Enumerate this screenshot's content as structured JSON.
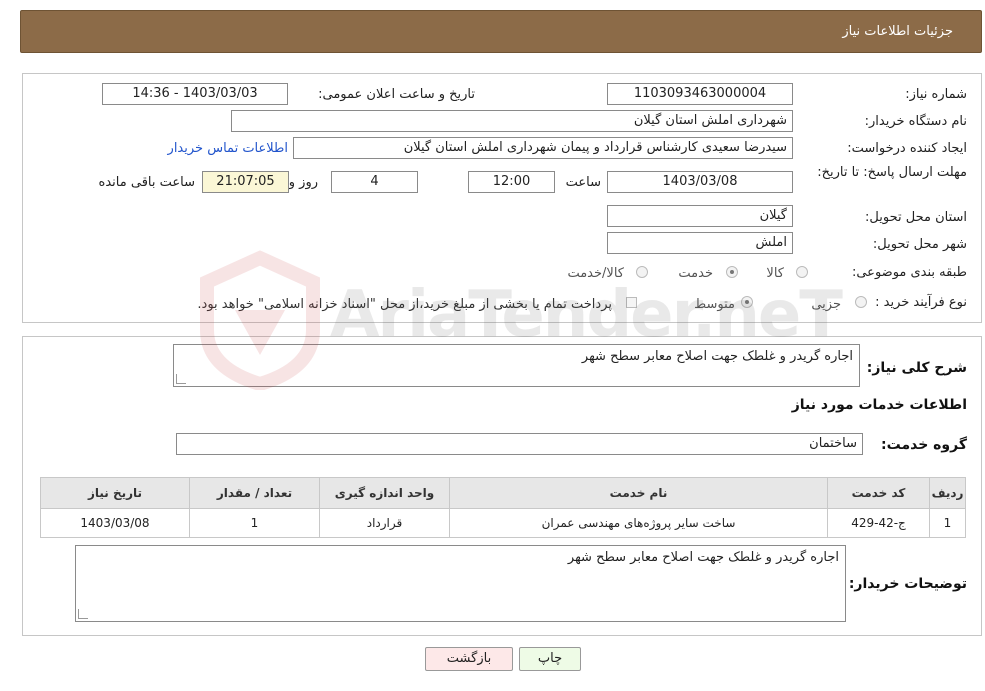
{
  "header": {
    "title": "جزئیات اطلاعات نیاز"
  },
  "form": {
    "need_number": {
      "label": "شماره نیاز:",
      "value": "1103093463000004"
    },
    "announce_datetime": {
      "label": "تاریخ و ساعت اعلان عمومی:",
      "value": "1403/03/03 - 14:36"
    },
    "buyer_org": {
      "label": "نام دستگاه خریدار:",
      "value": "شهرداری املش استان گیلان"
    },
    "creator": {
      "label": "ایجاد کننده درخواست:",
      "value": "سیدرضا سعیدی کارشناس قرارداد و پیمان شهرداری املش استان گیلان",
      "contact_link": "اطلاعات تماس خریدار"
    },
    "deadline": {
      "label": "مهلت ارسال پاسخ: تا تاریخ:",
      "date": "1403/03/08",
      "time_label": "ساعت",
      "time": "12:00",
      "days": "4",
      "days_label": "روز و",
      "remaining": "21:07:05",
      "remaining_label": "ساعت باقی مانده"
    },
    "delivery_province": {
      "label": "استان محل تحویل:",
      "value": "گیلان"
    },
    "delivery_city": {
      "label": "شهر محل تحویل:",
      "value": "املش"
    },
    "category": {
      "label": "طبقه بندی موضوعی:",
      "options": [
        "کالا",
        "خدمت",
        "کالا/خدمت"
      ],
      "selected": "خدمت"
    },
    "purchase_type": {
      "label": "نوع فرآیند خرید :",
      "options": [
        "جزیی",
        "متوسط"
      ],
      "selected": "متوسط",
      "payment_note": "پرداخت تمام یا بخشی از مبلغ خرید،از محل \"اسناد خزانه اسلامی\" خواهد بود."
    }
  },
  "summary": {
    "label": "شرح کلی نیاز:",
    "value": "اجاره گریدر و غلطک جهت اصلاح معابر سطح شهر"
  },
  "services": {
    "section_title": "اطلاعات خدمات مورد نیاز",
    "group_label": "گروه خدمت:",
    "group_value": "ساختمان",
    "columns": [
      "ردیف",
      "کد خدمت",
      "نام خدمت",
      "واحد اندازه گیری",
      "تعداد / مقدار",
      "تاریخ نیاز"
    ],
    "rows": [
      [
        "1",
        "ج-42-429",
        "ساخت سایر پروژه‌های مهندسی عمران",
        "قرارداد",
        "1",
        "1403/03/08"
      ]
    ]
  },
  "buyer_notes": {
    "label": "توضیحات خریدار:",
    "value": "اجاره گریدر و غلطک جهت اصلاح معابر سطح شهر"
  },
  "buttons": {
    "print": "چاپ",
    "back": "بازگشت"
  },
  "watermark": {
    "text": "AriaTender.neT"
  },
  "colors": {
    "header_bg": "#8c6b48",
    "link": "#2255cc",
    "print_btn": "#eefbe6",
    "back_btn": "#fde8e8"
  }
}
